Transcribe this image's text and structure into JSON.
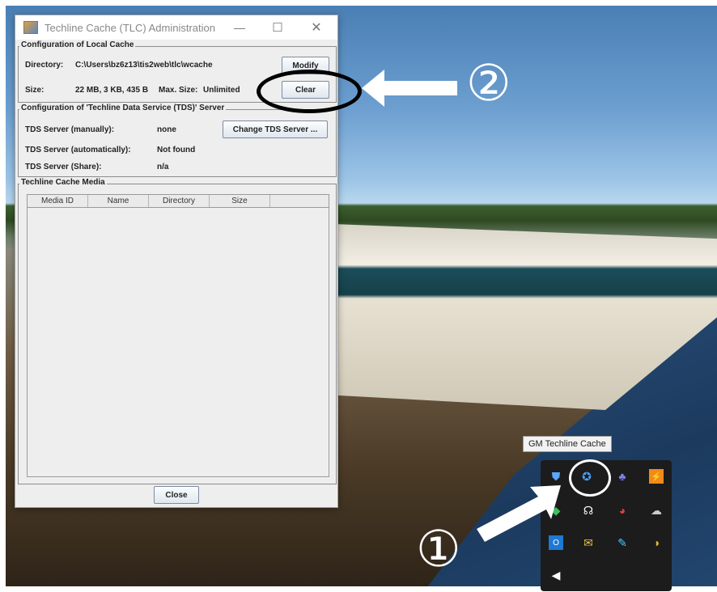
{
  "window": {
    "title": "Techline Cache (TLC) Administration",
    "minimize": "—",
    "maximize": "☐",
    "close": "✕"
  },
  "local_cache": {
    "group_label": "Configuration of Local Cache",
    "directory_label": "Directory:",
    "directory_value": "C:\\Users\\bz6z13\\tis2web\\tlc\\wcache",
    "modify_label": "Modify",
    "size_label": "Size:",
    "size_value": "22 MB, 3 KB, 435 B",
    "max_size_label": "Max. Size:",
    "max_size_value": "Unlimited",
    "clear_label": "Clear"
  },
  "tds": {
    "group_label": "Configuration of 'Techline Data Service (TDS)' Server",
    "manual_label": "TDS Server (manually):",
    "manual_value": "none",
    "change_label": "Change TDS Server ...",
    "auto_label": "TDS Server (automatically):",
    "auto_value": "Not found",
    "share_label": "TDS Server (Share):",
    "share_value": "n/a"
  },
  "media": {
    "group_label": "Techline Cache Media",
    "columns": [
      "Media ID",
      "Name",
      "Directory",
      "Size",
      ""
    ]
  },
  "footer": {
    "close_label": "Close"
  },
  "annotations": {
    "step1": "①",
    "step2": "②"
  },
  "tray": {
    "tooltip": "GM Techline Cache",
    "icons": [
      "shield-icon",
      "gm-techline-cache-icon",
      "teams-icon",
      "orange-app-icon",
      "green-app-icon",
      "headset-icon",
      "chrome-app-icon",
      "cloud-icon",
      "outlook-icon",
      "mail-icon",
      "pen-icon",
      "color-wheel-icon",
      "speaker-icon"
    ]
  },
  "colors": {
    "button_border": "#7a8ca0",
    "tray_bg": "#1c1c1c",
    "dialog_bg": "#eeeeee"
  }
}
